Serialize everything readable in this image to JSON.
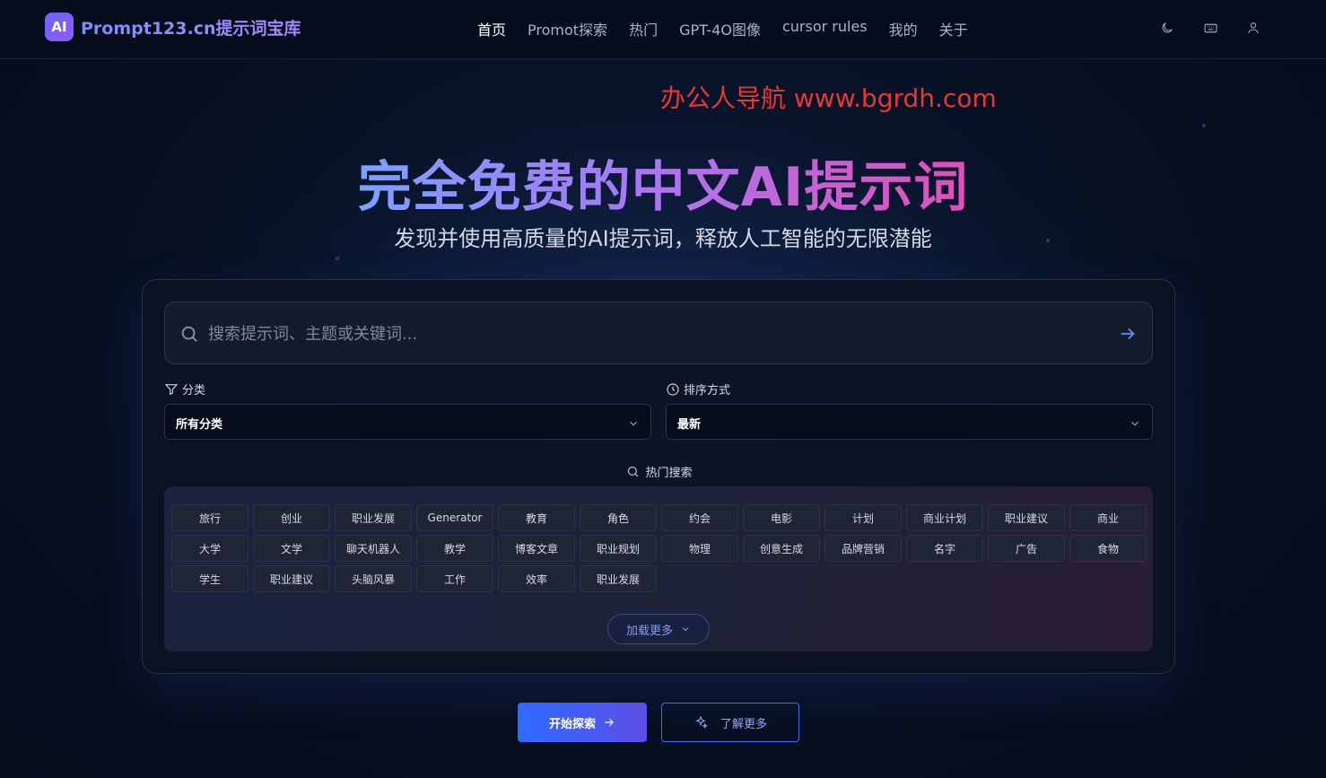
{
  "header": {
    "logo_badge": "AI",
    "logo_text": "Prompt123.cn提示词宝库",
    "nav": [
      {
        "label": "首页",
        "active": true
      },
      {
        "label": "Promot探索",
        "active": false
      },
      {
        "label": "热门",
        "active": false
      },
      {
        "label": "GPT-4O图像",
        "active": false
      },
      {
        "label": "cursor rules",
        "active": false
      },
      {
        "label": "我的",
        "active": false
      },
      {
        "label": "关于",
        "active": false
      }
    ],
    "icons": [
      "moon-icon",
      "keyboard-icon",
      "user-icon"
    ]
  },
  "watermark": "办公人导航  www.bgrdh.com",
  "hero": {
    "title": "完全免费的中文AI提示词",
    "subtitle": "发现并使用高质量的AI提示词，释放人工智能的无限潜能"
  },
  "search": {
    "placeholder": "搜索提示词、主题或关键词...",
    "value": ""
  },
  "filters": {
    "category_label": "分类",
    "category_value": "所有分类",
    "sort_label": "排序方式",
    "sort_value": "最新"
  },
  "hot": {
    "title": "热门搜索",
    "tags": [
      "旅行",
      "创业",
      "职业发展",
      "Generator",
      "教育",
      "角色",
      "约会",
      "电影",
      "计划",
      "商业计划",
      "职业建议",
      "商业",
      "大学",
      "文学",
      "聊天机器人",
      "教学",
      "博客文章",
      "职业规划",
      "物理",
      "创意生成",
      "品牌营销",
      "名字",
      "广告",
      "食物",
      "学生",
      "职业建议",
      "头脑风暴",
      "工作",
      "效率",
      "职业发展"
    ],
    "load_more": "加载更多"
  },
  "actions": {
    "start": "开始探索",
    "learn": "了解更多"
  },
  "colors": {
    "accent": "#2f6bff",
    "watermark": "#e53935",
    "gradient_start": "#7aa2ff",
    "gradient_end": "#e04fb8"
  }
}
